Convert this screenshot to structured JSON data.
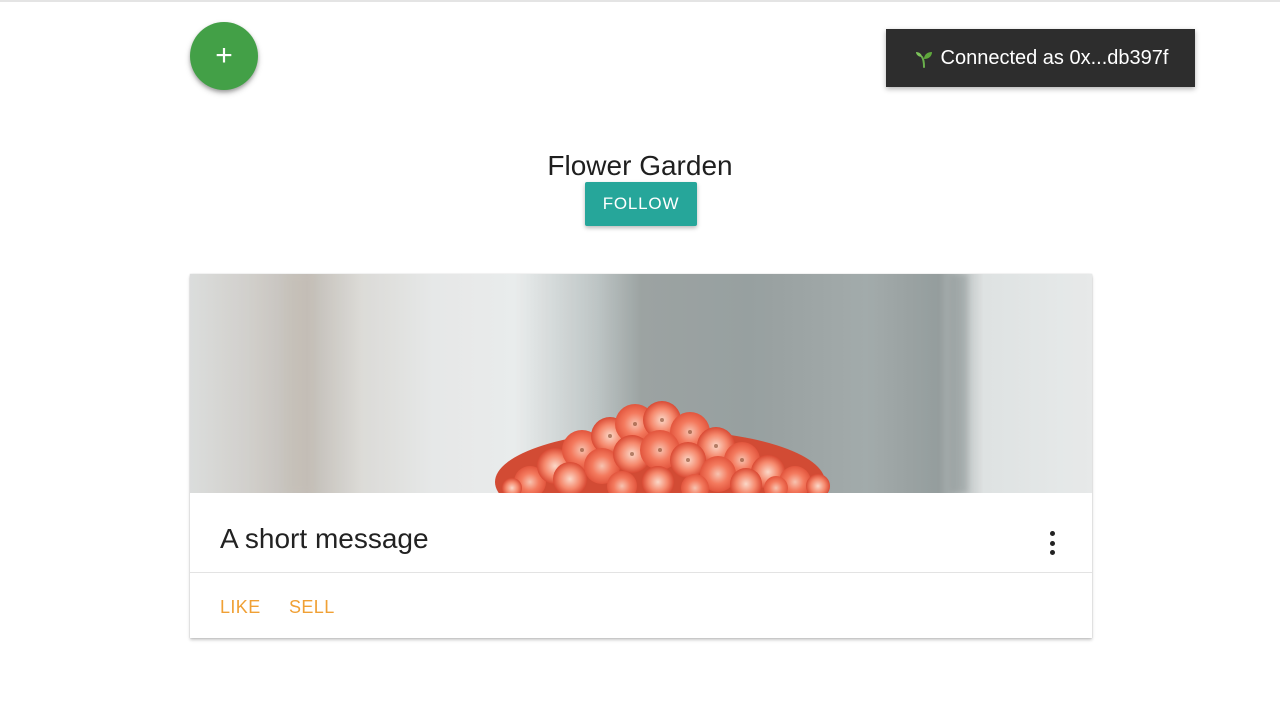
{
  "fab": {
    "label": "+"
  },
  "toast": {
    "text": "Connected as 0x...db397f",
    "icon": "sprout-icon"
  },
  "garden": {
    "title": "Flower Garden",
    "follow_label": "FOLLOW"
  },
  "card": {
    "image": "flower-photo",
    "message": "A short message",
    "menu_icon": "more-vert-icon",
    "actions": {
      "like_label": "LIKE",
      "sell_label": "SELL"
    }
  },
  "colors": {
    "fab": "#43a047",
    "follow": "#26a69a",
    "toast_bg": "#2d2d2d",
    "action_text": "#f0a035"
  }
}
